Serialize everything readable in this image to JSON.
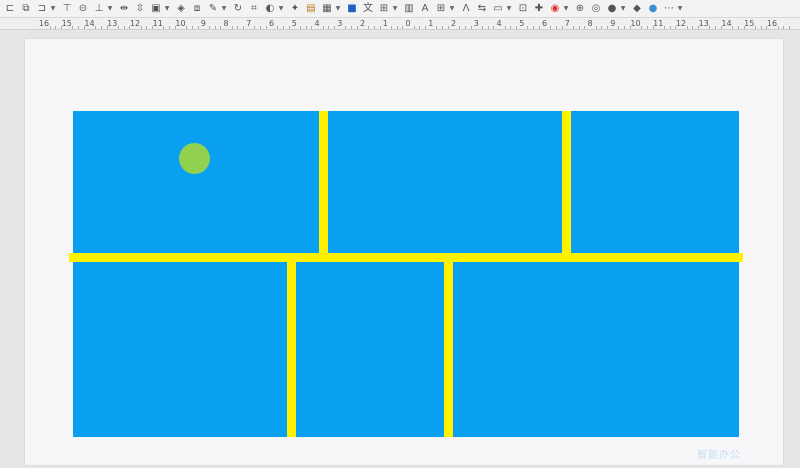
{
  "ruler": {
    "labels": [
      "16",
      "15",
      "14",
      "13",
      "12",
      "11",
      "10",
      "9",
      "8",
      "7",
      "6",
      "5",
      "4",
      "3",
      "2",
      "1",
      "0",
      "1",
      "2",
      "3",
      "4",
      "5",
      "6",
      "7",
      "8",
      "9",
      "10",
      "11",
      "12",
      "13",
      "14",
      "15",
      "16"
    ]
  },
  "toolbar": {
    "icons": [
      "align-left-icon",
      "copy-icon",
      "align-right-icon",
      "align-top-icon",
      "align-middle-icon",
      "align-bottom-icon",
      "distribute-h-icon",
      "distribute-v-icon",
      "group-icon",
      "shape-fill-icon",
      "arrange-icon",
      "eyedropper-icon",
      "rotate-icon",
      "crop-icon",
      "shadow-icon",
      "effects-icon",
      "image-icon",
      "picture-icon",
      "fill-color-icon",
      "text-icon",
      "textbox-icon",
      "chart-icon",
      "wordart-icon",
      "table-icon",
      "spacing-icon",
      "link-icon",
      "layout-icon",
      "transition-icon",
      "animation-icon",
      "record-icon",
      "smartart-icon",
      "theme-icon",
      "color-palette-icon",
      "shape-icon",
      "circle-icon",
      "more-icon"
    ]
  },
  "slide": {
    "fill_color": "#0aa0f2",
    "line_color": "#fff200",
    "dot_color": "#92d050"
  },
  "watermark": "智能办公"
}
